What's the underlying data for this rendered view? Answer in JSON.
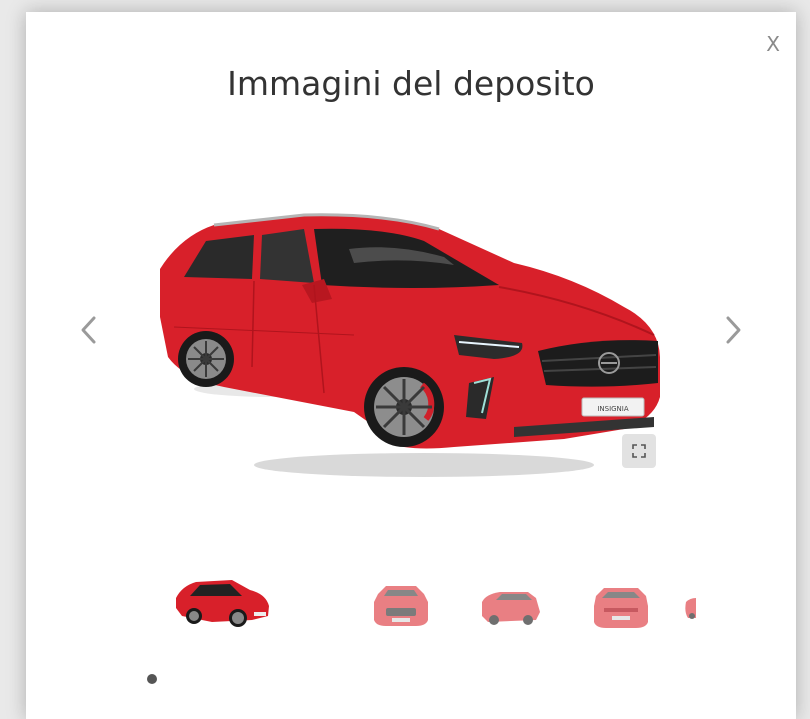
{
  "modal": {
    "title": "Immagini del deposito",
    "close_label": "X"
  },
  "car": {
    "color": "#d8202a",
    "plate_text": "INSIGNIA"
  },
  "gallery": {
    "current_index": 1,
    "thumbnail_count": 5,
    "indicator_count": 1
  },
  "icons": {
    "prev": "chevron-left-icon",
    "next": "chevron-right-icon",
    "expand": "expand-icon"
  }
}
